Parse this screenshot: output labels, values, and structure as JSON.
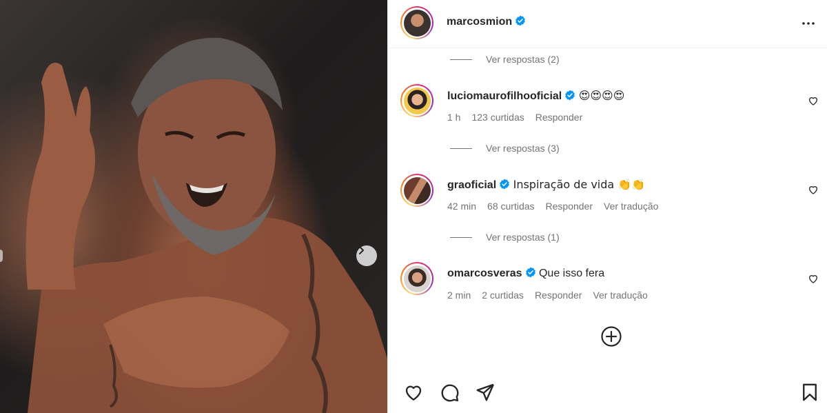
{
  "post": {
    "author": "marcosmion",
    "author_verified": true,
    "more_icon": "more-horizontal-icon"
  },
  "comments": [
    {
      "view_replies": "Ver respostas (2)"
    },
    {
      "user": "luciomaurofilhooficial",
      "verified": true,
      "text": "😍😍😍😍",
      "time": "1 h",
      "likes": "123 curtidas",
      "reply": "Responder",
      "view_replies": "Ver respostas (3)"
    },
    {
      "user": "graoficial",
      "verified": true,
      "text": "Inspiração de vida 👏👏",
      "time": "42 min",
      "likes": "68 curtidas",
      "reply": "Responder",
      "translate": "Ver tradução",
      "view_replies": "Ver respostas (1)"
    },
    {
      "user": "omarcosveras",
      "verified": true,
      "text": "Que isso fera",
      "time": "2 min",
      "likes": "2 curtidas",
      "reply": "Responder",
      "translate": "Ver tradução"
    }
  ],
  "icons": {
    "like": "heart-icon",
    "comment": "comment-bubble-icon",
    "share": "paper-plane-icon",
    "save": "bookmark-icon",
    "load_more": "plus-circle-icon",
    "next": "chevron-right-icon"
  },
  "colors": {
    "verified_blue": "#0095f6",
    "text": "#262626",
    "secondary": "#737373"
  }
}
